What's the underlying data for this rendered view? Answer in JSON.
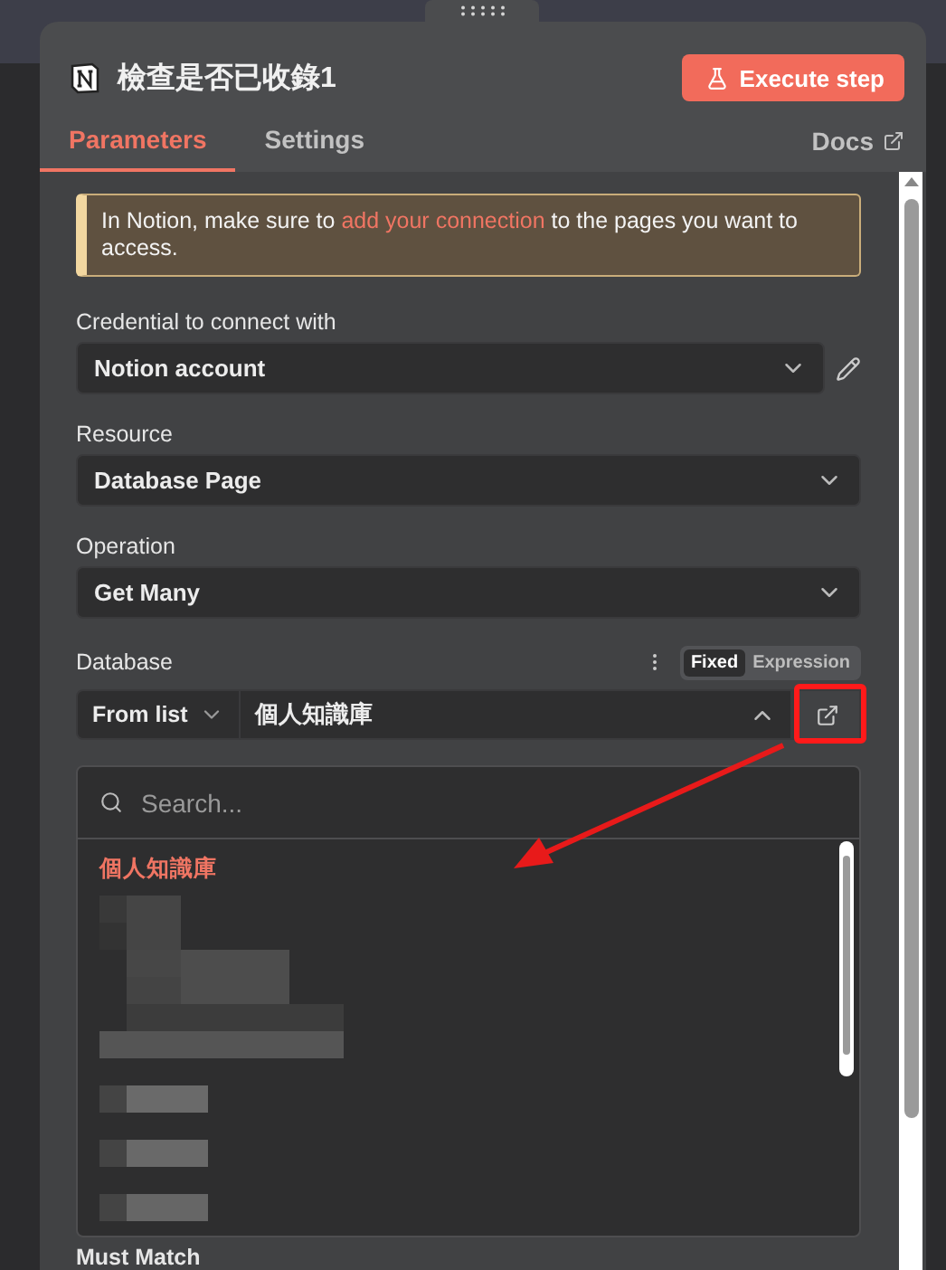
{
  "header": {
    "title": "檢查是否已收錄1",
    "execute_button": "Execute step"
  },
  "tabs": [
    {
      "label": "Parameters",
      "selected": true
    },
    {
      "label": "Settings",
      "selected": false
    }
  ],
  "docs_link": "Docs",
  "notice": {
    "text_before": "In Notion, make sure to ",
    "link": "add your connection",
    "text_after": " to the pages you want to access."
  },
  "fields": [
    {
      "kind": "credential",
      "label": "Credential to connect with",
      "value": "Notion account"
    },
    {
      "kind": "select",
      "label": "Resource",
      "value": "Database Page"
    },
    {
      "kind": "select",
      "label": "Operation",
      "value": "Get Many"
    }
  ],
  "database": {
    "label": "Database",
    "modes": [
      {
        "label": "Fixed",
        "selected": true
      },
      {
        "label": "Expression",
        "selected": false
      }
    ],
    "source": "From list",
    "value": "個人知識庫",
    "expanded": true,
    "dropdown": {
      "search_placeholder": "Search...",
      "items": [
        {
          "label": "個人知識庫",
          "selected": true
        }
      ]
    }
  },
  "next_label": "Must Match"
}
